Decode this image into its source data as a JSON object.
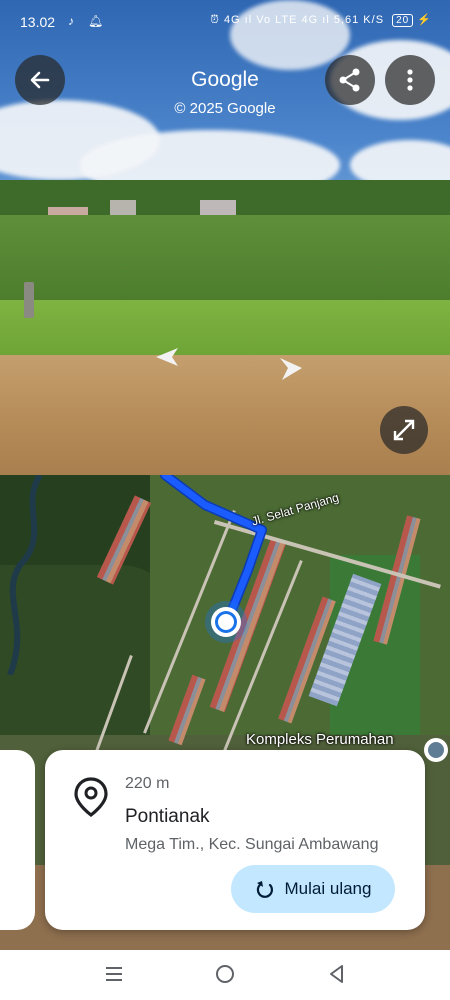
{
  "status_bar": {
    "time": "13.02",
    "network": "4G ıl Vo LTE 4G ıl",
    "speed": "5,61 K/S",
    "battery": "20"
  },
  "street_view": {
    "title": "Google",
    "copyright": "© 2025 Google"
  },
  "map": {
    "street_label": "Jl. Selat Panjang",
    "poi_label": "Kompleks Perumahan"
  },
  "card": {
    "distance": "220 m",
    "place_name": "Pontianak",
    "address": "Mega Tim., Kec. Sungai Ambawang",
    "restart_label": "Mulai ulang"
  },
  "colors": {
    "route": "#1a5cff",
    "button_bg": "#c2e7ff"
  }
}
